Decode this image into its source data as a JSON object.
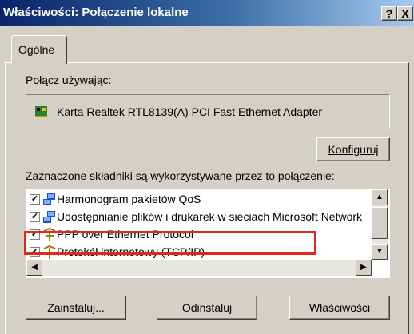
{
  "window": {
    "title": "Właściwości: Połączenie lokalne",
    "help_label": "?",
    "close_label": "X"
  },
  "tabs": [
    {
      "label": "Ogólne"
    }
  ],
  "connect_using": {
    "label": "Połącz używając:",
    "adapter_name": "Karta Realtek RTL8139(A) PCI Fast Ethernet Adapter",
    "configure_label": "Konfiguruj"
  },
  "components": {
    "label": "Zaznaczone składniki są wykorzystywane przez to połączenie:",
    "items": [
      {
        "label": "Harmonogram pakietów QoS",
        "checked": true,
        "icon": "network-service-icon"
      },
      {
        "label": "Udostępnianie plików i drukarek w sieciach Microsoft Network",
        "checked": true,
        "icon": "network-service-icon"
      },
      {
        "label": "PPP over Ethernet Protocol",
        "checked": true,
        "icon": "protocol-icon",
        "highlighted": true
      },
      {
        "label": "Protokół internetowy (TCP/IP)",
        "checked": true,
        "icon": "protocol-icon"
      }
    ],
    "highlight_color": "#e0281e"
  },
  "buttons": {
    "install": "Zainstaluj...",
    "uninstall": "Odinstaluj",
    "properties": "Właściwości"
  },
  "colors": {
    "titlebar_start": "#0a246a",
    "titlebar_end": "#a6caf0",
    "dialog_bg": "#d4d0c8"
  }
}
